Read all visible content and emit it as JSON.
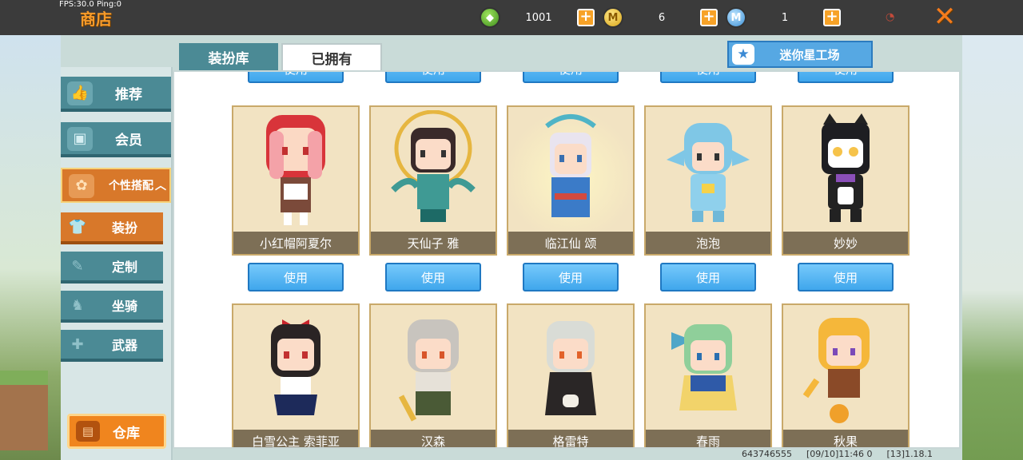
{
  "hud": {
    "fps": "FPS:30.0  Ping:0",
    "title": "商店"
  },
  "currencies": [
    {
      "icon": "green-gem-icon",
      "amount": "1001"
    },
    {
      "icon": "gold-coin-icon",
      "amount": "6"
    },
    {
      "icon": "blue-coin-icon",
      "amount": "1"
    }
  ],
  "sidebar": {
    "recommend": "推荐",
    "member": "会员",
    "personal": "个性搭配",
    "dressup": "装扮",
    "custom": "定制",
    "mount": "坐骑",
    "weapon": "武器",
    "warehouse": "仓库"
  },
  "tabs": {
    "library": "装扮库",
    "owned": "已拥有",
    "studio": "迷你星工场"
  },
  "use_label": "使用",
  "cards_row1": [
    "小红帽阿夏尔",
    "天仙子 雅",
    "临江仙 颂",
    "泡泡",
    "妙妙"
  ],
  "cards_row2": [
    "白雪公主 索菲亚",
    "汉森",
    "格雷特",
    "春雨",
    "秋果"
  ],
  "footer": {
    "id": "643746555",
    "time": "[09/10]11:46 0",
    "version": "[13]1.18.1"
  }
}
